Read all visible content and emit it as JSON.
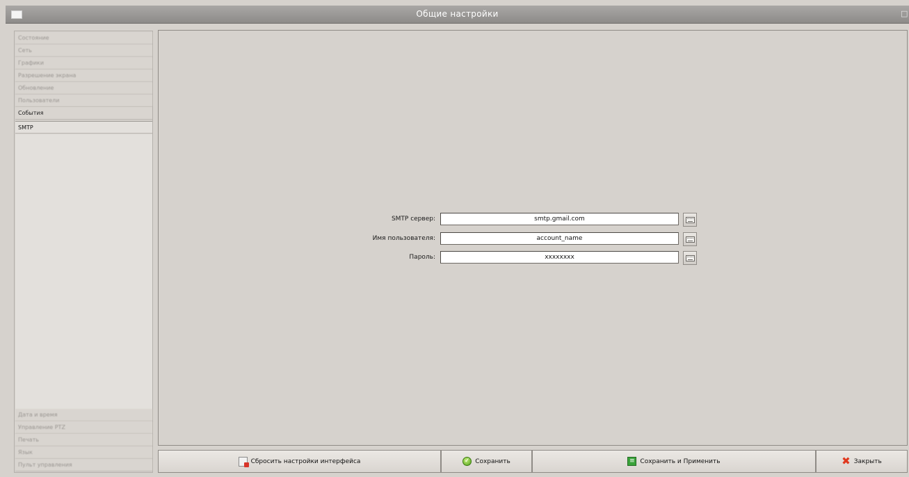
{
  "window": {
    "title": "Общие настройки",
    "controls": {
      "maximize": "□",
      "close": "×"
    }
  },
  "sidebar": {
    "items": [
      {
        "label": "Состояние"
      },
      {
        "label": "Сеть"
      },
      {
        "label": "Графики"
      },
      {
        "label": "Разрешение экрана"
      },
      {
        "label": "Обновление"
      },
      {
        "label": "Пользователи"
      },
      {
        "label": "События"
      },
      {
        "label": "SMTP"
      }
    ],
    "bottom_items": [
      {
        "label": "Дата и время"
      },
      {
        "label": "Управление PTZ"
      },
      {
        "label": "Печать"
      },
      {
        "label": "Язык"
      },
      {
        "label": "Пульт управления"
      }
    ],
    "selected": "SMTP"
  },
  "smtp_form": {
    "server_label": "SMTP сервер:",
    "server_value": "smtp.gmail.com",
    "username_label": "Имя пользователя:",
    "username_value": "account_name",
    "password_label": "Пароль:",
    "password_value": "xxxxxxxx"
  },
  "footer": {
    "reset_label": "Сбросить настройки интерфейса",
    "save_label": "Сохранить",
    "save_apply_label": "Сохранить и Применить",
    "close_label": "Закрыть"
  },
  "colors": {
    "background": "#d6d2cd",
    "titlebar": "#9b9997",
    "close_icon": "#e0391f",
    "save_icon": "#4e9e18"
  }
}
